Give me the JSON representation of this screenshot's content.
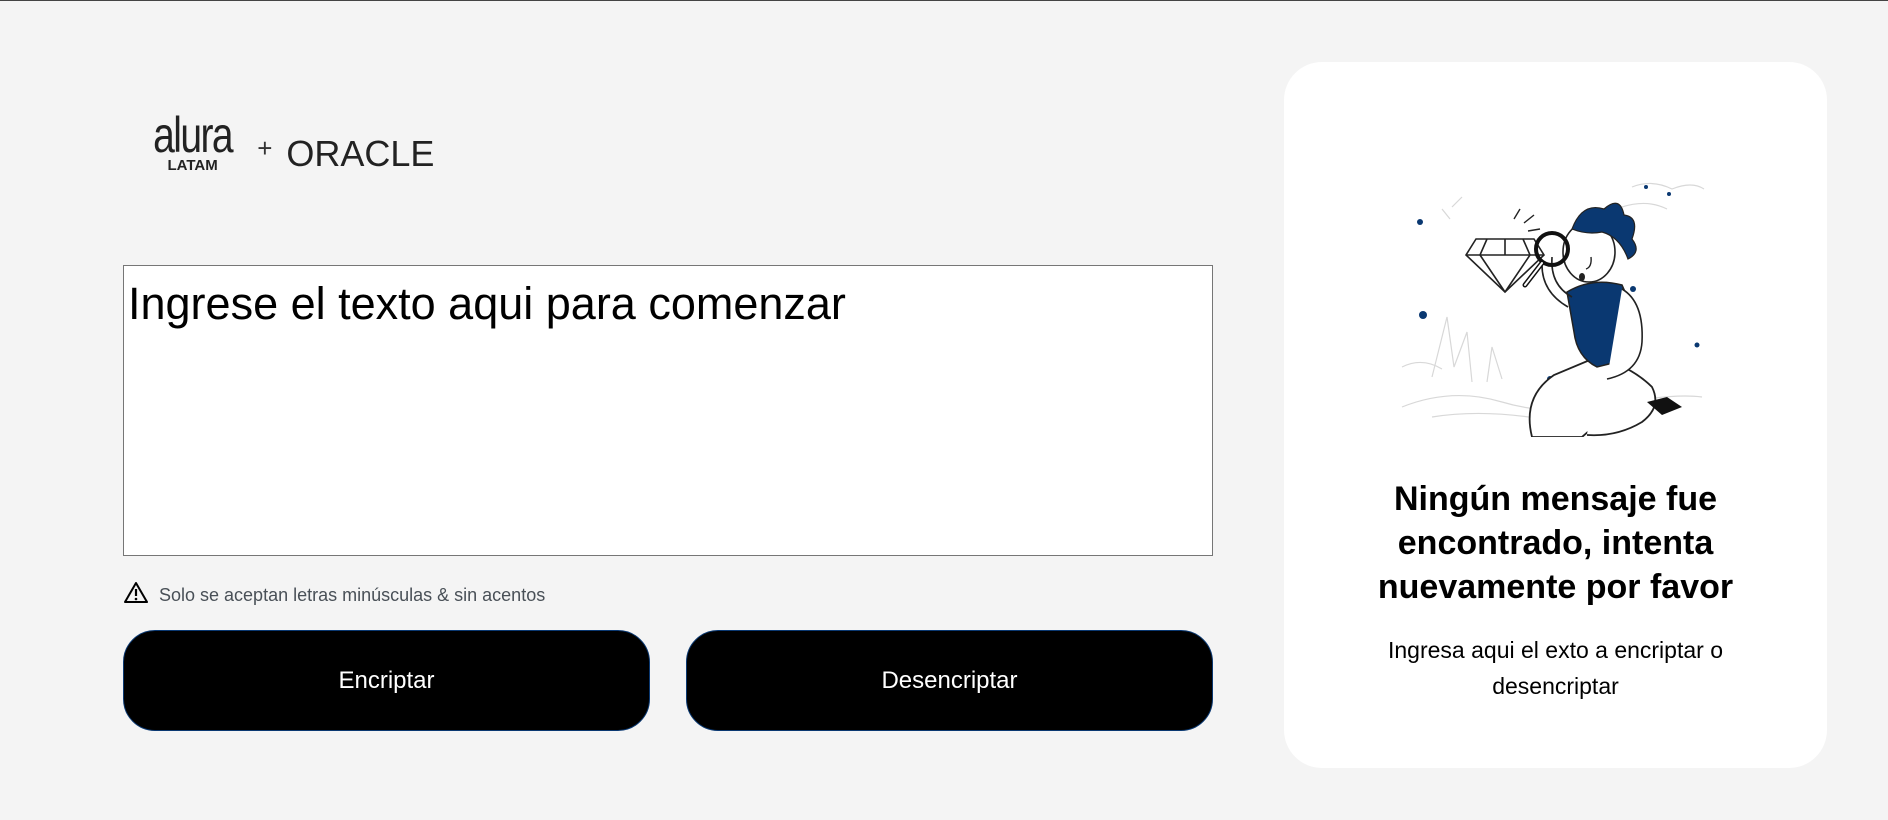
{
  "brand": {
    "alura_word": "alura",
    "alura_sub": "LATAM",
    "plus": "+",
    "oracle": "ORACLE"
  },
  "input": {
    "placeholder": "Ingrese el texto aqui para comenzar",
    "value": ""
  },
  "warning": {
    "icon": "warning-triangle-icon",
    "text": "Solo se aceptan letras minúsculas & sin acentos"
  },
  "buttons": {
    "encrypt_label": "Encriptar",
    "decrypt_label": "Desencriptar"
  },
  "output_card": {
    "illustration": "person-with-magnifying-glass-and-diamond",
    "title": "Ningún mensaje fue encontrado, intenta nuevamente por favor",
    "text": "Ingresa aqui el exto a encriptar o desencriptar"
  },
  "colors": {
    "background": "#f4f4f4",
    "button_bg": "#000000",
    "button_text": "#ffffff",
    "accent_blue": "#0a3871",
    "card_bg": "#ffffff"
  }
}
